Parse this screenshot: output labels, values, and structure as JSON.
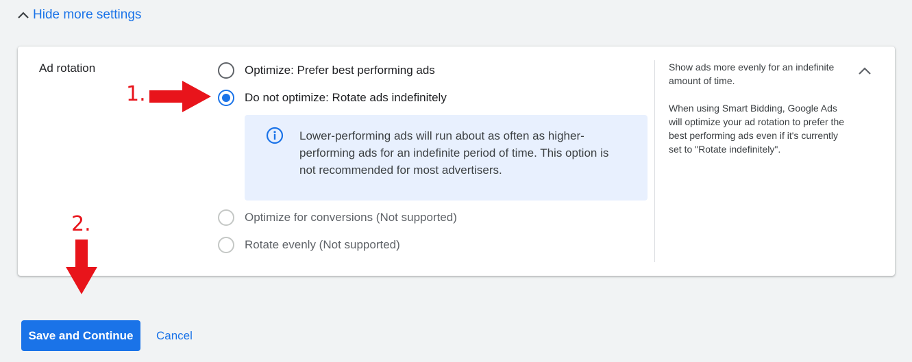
{
  "toggle": {
    "label": "Hide more settings",
    "icon": "chevron-up-icon"
  },
  "card": {
    "title": "Ad rotation",
    "options": [
      {
        "label": "Optimize: Prefer best performing ads",
        "checked": false,
        "disabled": false
      },
      {
        "label": "Do not optimize: Rotate ads indefinitely",
        "checked": true,
        "disabled": false
      },
      {
        "label": "Optimize for conversions (Not supported)",
        "checked": false,
        "disabled": true
      },
      {
        "label": "Rotate evenly (Not supported)",
        "checked": false,
        "disabled": true
      }
    ],
    "info": {
      "icon": "info-icon",
      "text": "Lower-performing ads will run about as often as higher-performing ads for an indefinite period of time. This option is not recommended for most advertisers."
    },
    "help": {
      "paragraph1": "Show ads more evenly for an indefinite amount of time.",
      "paragraph2": "When using Smart Bidding, Google Ads will optimize your ad rotation to prefer the best performing ads even if it's currently set to \"Rotate indefinitely\"."
    },
    "collapse_icon": "chevron-up-icon"
  },
  "annotations": {
    "step1": "1.",
    "step2": "2.",
    "arrow_color": "#e8141b"
  },
  "actions": {
    "save_label": "Save and Continue",
    "cancel_label": "Cancel"
  },
  "colors": {
    "accent": "#1a73e8",
    "info_bg": "#e8f0fe",
    "page_bg": "#f1f3f4"
  }
}
